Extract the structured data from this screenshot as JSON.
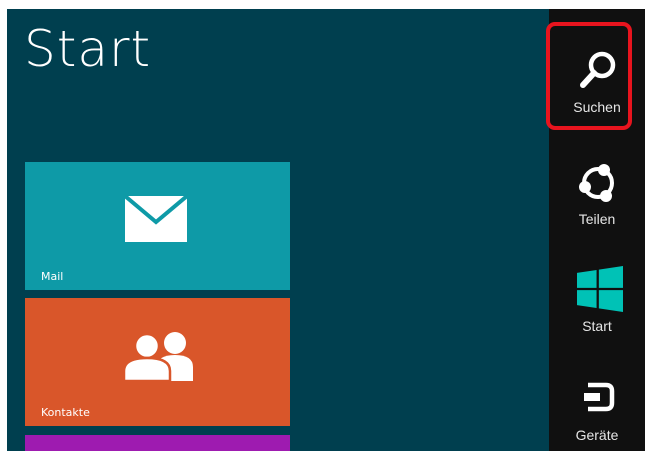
{
  "start_screen": {
    "title": "Start",
    "tiles": [
      {
        "label": "Mail",
        "color": "#0E9AA7",
        "icon": "mail-icon"
      },
      {
        "label": "Kontakte",
        "color": "#D9562A",
        "icon": "people-icon"
      },
      {
        "label": "",
        "color": "#9E1BB0",
        "icon": ""
      }
    ]
  },
  "charms_bar": {
    "items": [
      {
        "label": "Suchen",
        "icon": "search-icon",
        "highlighted": true
      },
      {
        "label": "Teilen",
        "icon": "share-icon"
      },
      {
        "label": "Start",
        "icon": "windows-logo-icon"
      },
      {
        "label": "Geräte",
        "icon": "devices-icon"
      }
    ],
    "highlight_color": "#E8141E"
  },
  "colors": {
    "background": "#003F4F",
    "charms_background": "#101010",
    "windows_logo": "#00C2B6"
  }
}
